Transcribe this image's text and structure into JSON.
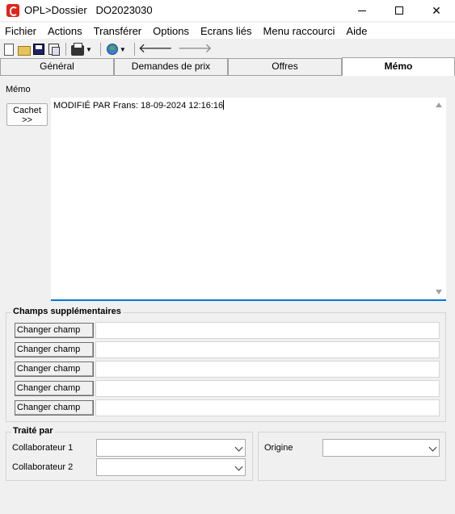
{
  "window": {
    "title": "OPL>Dossier   DO2023030",
    "minimize": "",
    "maximize": "",
    "close": "✕"
  },
  "menu": [
    "Fichier",
    "Actions",
    "Transférer",
    "Options",
    "Ecrans liés",
    "Menu raccourci",
    "Aide"
  ],
  "toolbar": {
    "icons": [
      "new-document-icon",
      "open-folder-icon",
      "save-icon",
      "copy-icon",
      "print-icon",
      "globe-icon",
      "back-arrow-icon",
      "forward-arrow-icon"
    ],
    "back": "🡐",
    "forward": "🡒",
    "caret": "▼"
  },
  "tabs": [
    {
      "label": "Général",
      "active": false
    },
    {
      "label": "Demandes de prix",
      "active": false
    },
    {
      "label": "Offres",
      "active": false
    },
    {
      "label": "Mémo",
      "active": true
    }
  ],
  "memo": {
    "label": "Mémo",
    "cachet_line1": "Cachet",
    "cachet_line2": ">>",
    "text": "MODIFIÉ PAR Frans: 18-09-2024 12:16:16"
  },
  "champs": {
    "title": "Champs supplémentaires",
    "rows": [
      {
        "button": "Changer champ",
        "value": ""
      },
      {
        "button": "Changer champ",
        "value": ""
      },
      {
        "button": "Changer champ",
        "value": ""
      },
      {
        "button": "Changer champ",
        "value": ""
      },
      {
        "button": "Changer champ",
        "value": ""
      }
    ]
  },
  "traite": {
    "title": "Traité par",
    "collab1_label": "Collaborateur 1",
    "collab1_value": "",
    "collab2_label": "Collaborateur 2",
    "collab2_value": ""
  },
  "origine": {
    "label": "Origine",
    "value": ""
  },
  "colors": {
    "accent": "#0078d7",
    "app_icon": "#e2231a"
  }
}
